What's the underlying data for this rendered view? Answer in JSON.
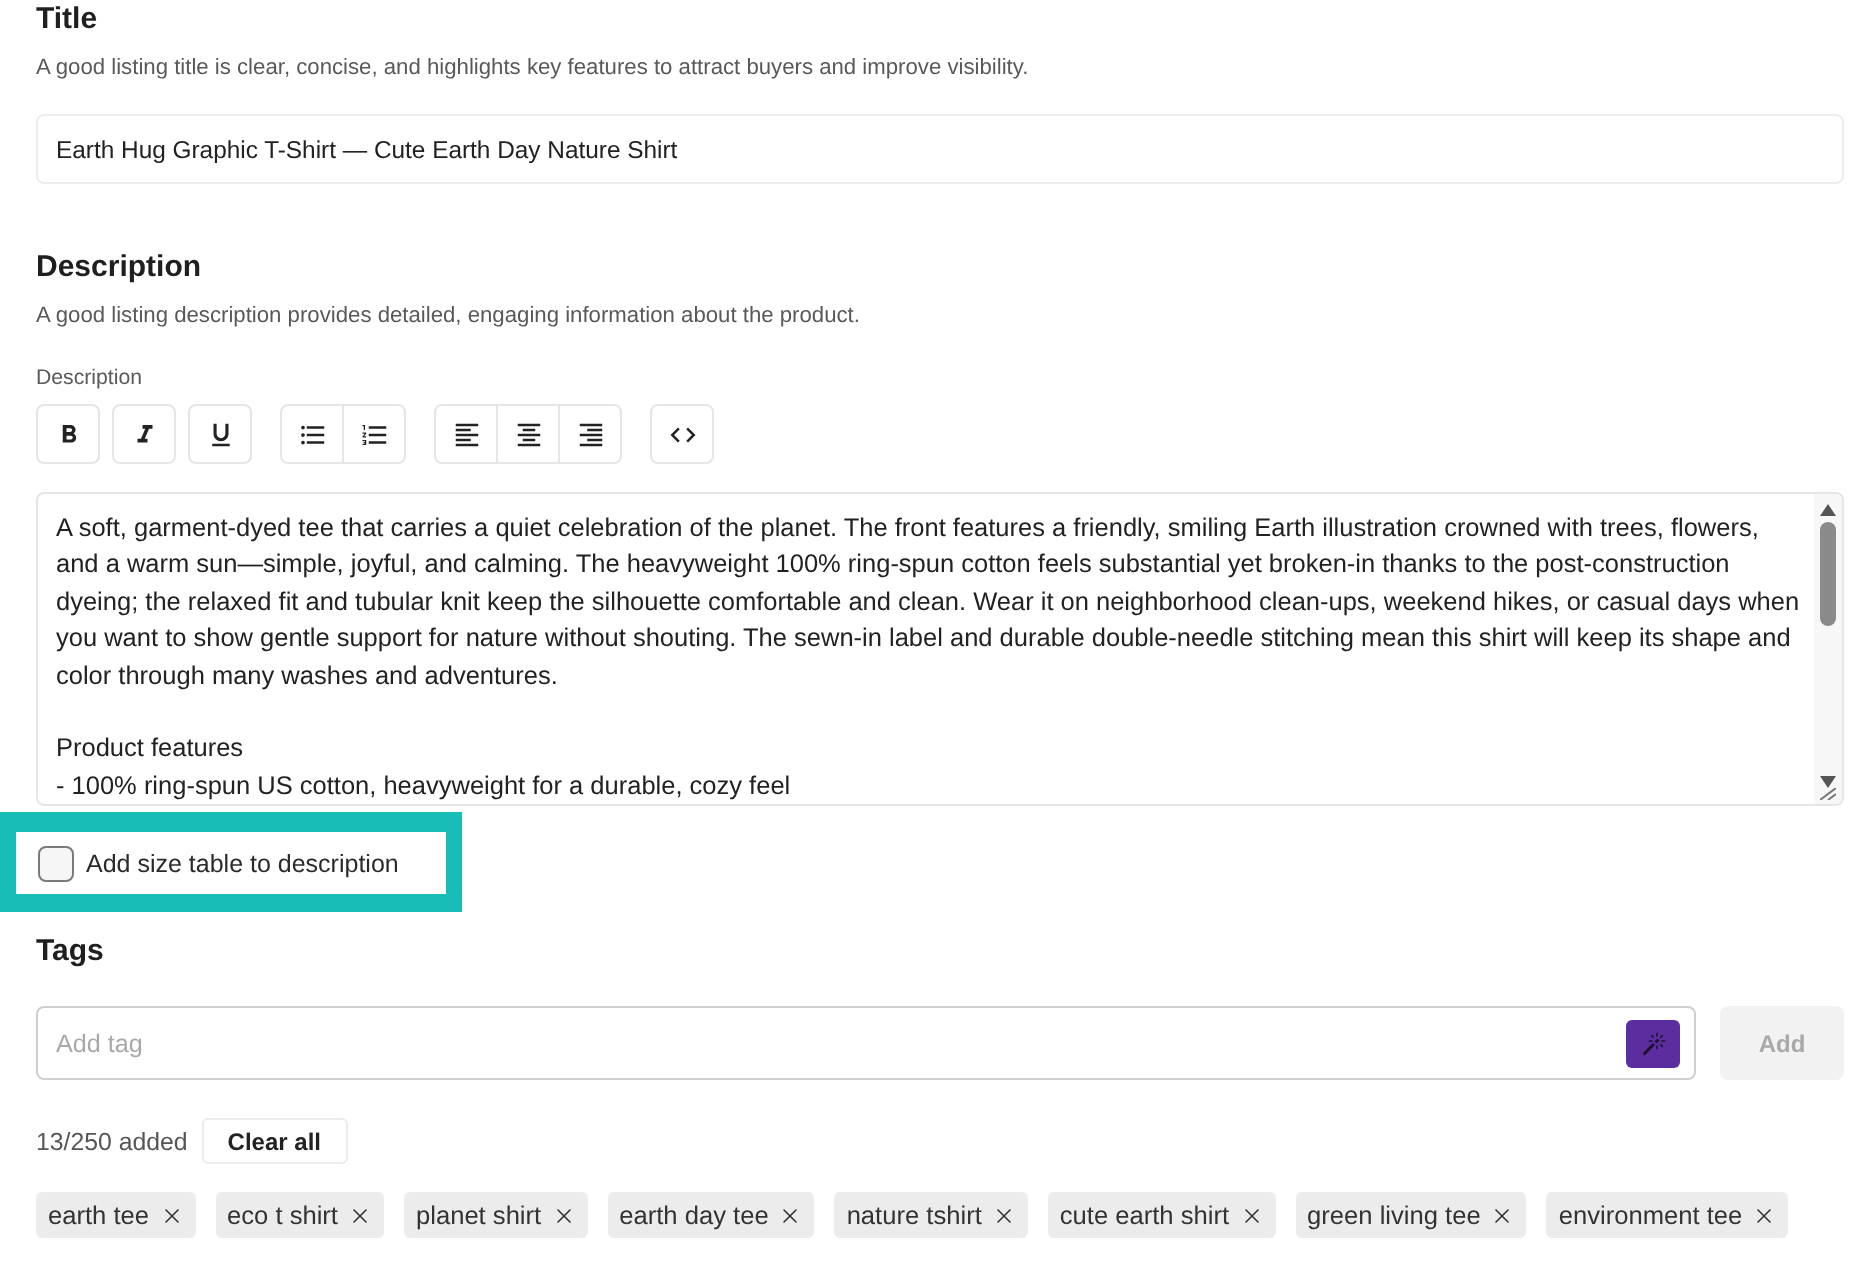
{
  "title_section": {
    "heading": "Title",
    "hint": "A good listing title is clear, concise, and highlights key features to attract buyers and improve visibility.",
    "value": "Earth Hug Graphic T-Shirt — Cute Earth Day Nature Shirt"
  },
  "description_section": {
    "heading": "Description",
    "hint": "A good listing description provides detailed, engaging information about the product.",
    "field_label": "Description",
    "toolbar": [
      {
        "buttons": [
          {
            "kind": "bold"
          }
        ]
      },
      {
        "buttons": [
          {
            "kind": "italic"
          }
        ]
      },
      {
        "buttons": [
          {
            "kind": "underline"
          }
        ]
      },
      {
        "buttons": [
          {
            "kind": "bullet_list"
          },
          {
            "kind": "numbered_list"
          }
        ]
      },
      {
        "buttons": [
          {
            "kind": "align_left"
          },
          {
            "kind": "align_center"
          },
          {
            "kind": "align_right"
          }
        ]
      },
      {
        "buttons": [
          {
            "kind": "code"
          }
        ]
      }
    ],
    "value": "A soft, garment-dyed tee that carries a quiet celebration of the planet. The front features a friendly, smiling Earth illustration crowned with trees, flowers, and a warm sun—simple, joyful, and calming. The heavyweight 100% ring-spun cotton feels substantial yet broken-in thanks to the post-construction dyeing; the relaxed fit and tubular knit keep the silhouette comfortable and clean. Wear it on neighborhood clean-ups, weekend hikes, or casual days when you want to show gentle support for nature without shouting. The sewn-in label and durable double-needle stitching mean this shirt will keep its shape and color through many washes and adventures.\n\nProduct features\n- 100% ring-spun US cotton, heavyweight for a durable, cozy feel",
    "size_table_option": {
      "label": "Add size table to description",
      "checked": false,
      "highlighted": true
    }
  },
  "tags_section": {
    "heading": "Tags",
    "input": {
      "placeholder": "Add tag"
    },
    "add_button": {
      "label": "Add",
      "disabled": true
    },
    "count": "13/250 added",
    "clear_button": "Clear all",
    "tags": [
      "earth tee",
      "eco t shirt",
      "planet shirt",
      "earth day tee",
      "nature tshirt",
      "cute earth shirt",
      "green living tee",
      "environment tee"
    ]
  }
}
